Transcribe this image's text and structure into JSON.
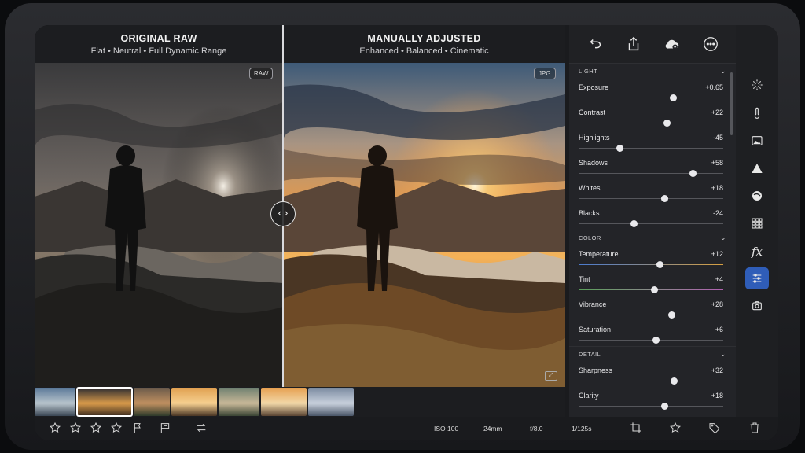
{
  "compare": {
    "left": {
      "title": "ORIGINAL RAW",
      "subtitle": "Flat • Neutral • Full Dynamic Range",
      "badge": "RAW"
    },
    "right": {
      "title": "MANUALLY ADJUSTED",
      "subtitle": "Enhanced • Balanced • Cinematic",
      "badge": "JPG"
    },
    "handle": "‹ ›"
  },
  "panel": {
    "icons": [
      "undo-icon",
      "share-icon",
      "cloud-sync-icon",
      "more-icon"
    ],
    "sections": [
      {
        "title": "LIGHT",
        "sliders": [
          {
            "label": "Exposure",
            "value": "+0.65",
            "level": 0.65
          },
          {
            "label": "Contrast",
            "value": "+22",
            "level": 0.61
          },
          {
            "label": "Highlights",
            "value": "-45",
            "level": 0.28
          },
          {
            "label": "Shadows",
            "value": "+58",
            "level": 0.79
          },
          {
            "label": "Whites",
            "value": "+18",
            "level": 0.59
          },
          {
            "label": "Blacks",
            "value": "-24",
            "level": 0.38
          }
        ]
      },
      {
        "title": "COLOR",
        "sliders": [
          {
            "label": "Temperature",
            "value": "+12",
            "level": 0.56
          },
          {
            "label": "Tint",
            "value": "+4",
            "level": 0.52
          },
          {
            "label": "Vibrance",
            "value": "+28",
            "level": 0.64
          },
          {
            "label": "Saturation",
            "value": "+6",
            "level": 0.53
          }
        ]
      },
      {
        "title": "DETAIL",
        "sliders": [
          {
            "label": "Sharpness",
            "value": "+32",
            "level": 0.66
          },
          {
            "label": "Clarity",
            "value": "+18",
            "level": 0.59
          }
        ]
      }
    ]
  },
  "tools": [
    "sun-icon",
    "thermometer-icon",
    "image-icon",
    "triangle-icon",
    "globe-icon",
    "grid-icon",
    "fx-icon",
    "sliders-icon",
    "auto-enhance-icon"
  ],
  "tools_fx_label": "fx",
  "bottombar": {
    "exif": {
      "iso": "ISO 100",
      "focal": "24mm",
      "aperture": "f/8.0",
      "shutter": "1/125s"
    }
  },
  "filmstrip": {
    "count": 7,
    "selected_index": 1
  }
}
